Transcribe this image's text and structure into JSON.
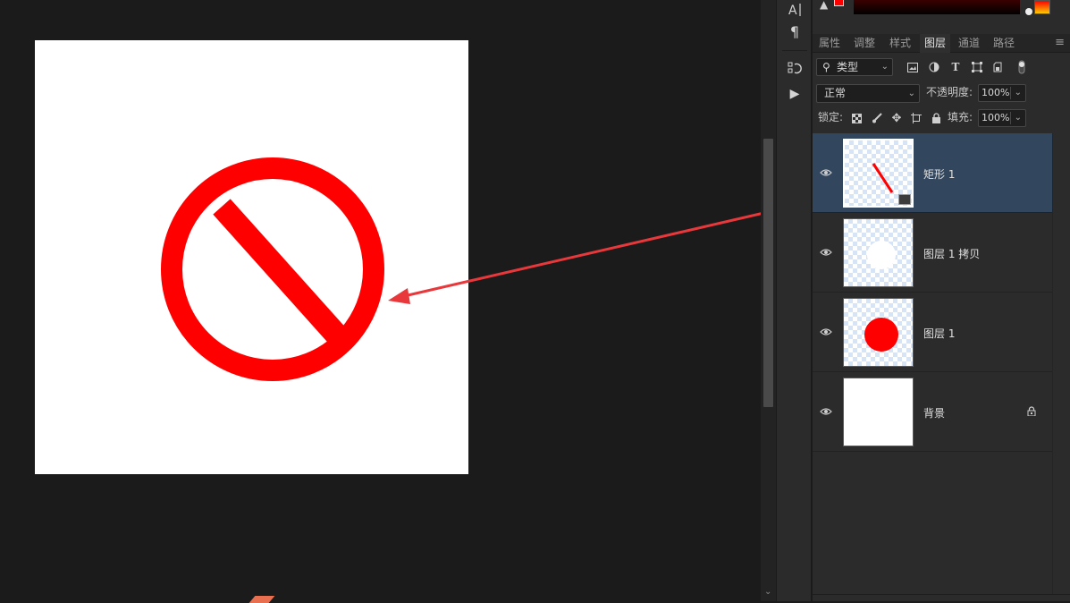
{
  "colors": {
    "accent_red": "#ff0000",
    "annotation_arrow": "#e8383b",
    "selected_layer_bg": "#32465e",
    "panel_bg": "#2b2b2b",
    "workspace_bg": "#1b1b1b"
  },
  "toolbar": {
    "items": [
      {
        "icon": "text-tool-icon",
        "glyph": "A|"
      },
      {
        "icon": "paragraph-icon",
        "glyph": "¶"
      },
      {
        "icon": "history-icon",
        "glyph": "⟲"
      },
      {
        "icon": "play-icon",
        "glyph": "▶"
      }
    ]
  },
  "panel": {
    "tabs": [
      {
        "label": "属性",
        "active": false
      },
      {
        "label": "调整",
        "active": false
      },
      {
        "label": "样式",
        "active": false
      },
      {
        "label": "图层",
        "active": true
      },
      {
        "label": "通道",
        "active": false
      },
      {
        "label": "路径",
        "active": false
      }
    ],
    "menu_icon": "panel-menu-icon"
  },
  "filter": {
    "kind_value": "类型",
    "icons": [
      "image-filter-icon",
      "adjustment-filter-icon",
      "text-filter-icon",
      "shape-filter-icon",
      "smart-object-filter-icon",
      "filter-toggle-icon"
    ]
  },
  "blend": {
    "mode_value": "正常",
    "opacity_label": "不透明度:",
    "opacity_value": "100%"
  },
  "lock": {
    "label": "锁定:",
    "icons": [
      "lock-transparent-icon",
      "lock-paint-icon",
      "lock-position-icon",
      "lock-artboard-icon",
      "lock-all-icon"
    ],
    "fill_label": "填充:",
    "fill_value": "100%"
  },
  "layers": [
    {
      "name": "矩形 1",
      "visible": true,
      "selected": true,
      "thumb": "red-slash",
      "locked": false
    },
    {
      "name": "图层 1 拷贝",
      "visible": true,
      "selected": false,
      "thumb": "white-circle",
      "locked": false
    },
    {
      "name": "图层 1",
      "visible": true,
      "selected": false,
      "thumb": "red-circle",
      "locked": false
    },
    {
      "name": "背景",
      "visible": true,
      "selected": false,
      "thumb": "white",
      "locked": true
    }
  ]
}
